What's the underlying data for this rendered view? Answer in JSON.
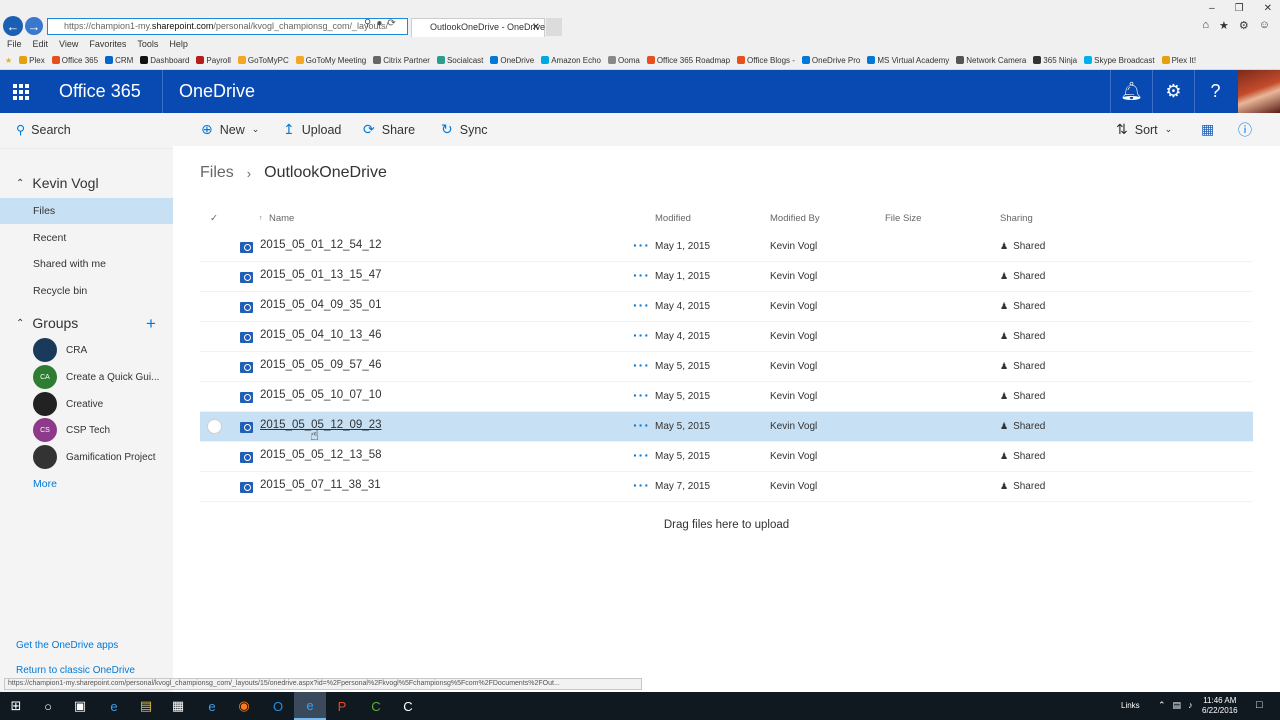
{
  "browser": {
    "address_prefix": "https://champion1-my.",
    "address_domain": "sharepoint.com",
    "address_suffix": "/personal/kvogl_championsg_com/_layouts/",
    "tab_title": "OutlookOneDrive - OneDrive",
    "status_url": "https://champion1-my.sharepoint.com/personal/kvogl_championsg_com/_layouts/15/onedrive.aspx?id=%2Fpersonal%2Fkvogl%5Fchampionsg%5Fcom%2FDocuments%2FOut..."
  },
  "menubar": [
    "File",
    "Edit",
    "View",
    "Favorites",
    "Tools",
    "Help"
  ],
  "favorites": [
    {
      "label": "Plex",
      "color": "#e5a00d"
    },
    {
      "label": "Office 365",
      "color": "#e84d1c"
    },
    {
      "label": "CRM",
      "color": "#0066cc"
    },
    {
      "label": "Dashboard",
      "color": "#111111"
    },
    {
      "label": "Payroll",
      "color": "#b71c1c"
    },
    {
      "label": "GoToMyPC",
      "color": "#f5a623"
    },
    {
      "label": "GoToMy Meeting",
      "color": "#f5a623"
    },
    {
      "label": "Citrix Partner",
      "color": "#666666"
    },
    {
      "label": "Socialcast",
      "color": "#2a9d8f"
    },
    {
      "label": "OneDrive",
      "color": "#0078d7"
    },
    {
      "label": "Amazon Echo",
      "color": "#00a8e1"
    },
    {
      "label": "Ooma",
      "color": "#888888"
    },
    {
      "label": "Office 365 Roadmap",
      "color": "#e84d1c"
    },
    {
      "label": "Office Blogs -",
      "color": "#e84d1c"
    },
    {
      "label": "OneDrive Pro",
      "color": "#0078d7"
    },
    {
      "label": "MS Virtual Academy",
      "color": "#0078d7"
    },
    {
      "label": "Network Camera",
      "color": "#555555"
    },
    {
      "label": "365 Ninja",
      "color": "#333333"
    },
    {
      "label": "Skype Broadcast",
      "color": "#00aff0"
    },
    {
      "label": "Plex It!",
      "color": "#e5a00d"
    }
  ],
  "suite": {
    "brand": "Office 365",
    "app": "OneDrive"
  },
  "leftnav": {
    "search": "Search",
    "user": "Kevin Vogl",
    "items": [
      "Files",
      "Recent",
      "Shared with me",
      "Recycle bin"
    ],
    "groups_title": "Groups",
    "groups": [
      {
        "name": "CRA",
        "initials": "",
        "color": "#1a3a5c"
      },
      {
        "name": "Create a Quick Gui...",
        "initials": "CA",
        "color": "#2e7d32"
      },
      {
        "name": "Creative",
        "initials": "",
        "color": "#222222"
      },
      {
        "name": "CSP Tech",
        "initials": "CS",
        "color": "#8e3a8a"
      },
      {
        "name": "Gamification Project",
        "initials": "",
        "color": "#333333"
      }
    ],
    "more": "More",
    "get_apps": "Get the OneDrive apps",
    "classic": "Return to classic OneDrive"
  },
  "commands": {
    "new": "New",
    "upload": "Upload",
    "share": "Share",
    "sync": "Sync",
    "sort": "Sort"
  },
  "breadcrumb": {
    "root": "Files",
    "current": "OutlookOneDrive"
  },
  "columns": {
    "name": "Name",
    "modified": "Modified",
    "modified_by": "Modified By",
    "size": "File Size",
    "sharing": "Sharing"
  },
  "files": [
    {
      "name": "2015_05_01_12_54_12",
      "modified": "May 1, 2015",
      "by": "Kevin Vogl",
      "sharing": "Shared"
    },
    {
      "name": "2015_05_01_13_15_47",
      "modified": "May 1, 2015",
      "by": "Kevin Vogl",
      "sharing": "Shared"
    },
    {
      "name": "2015_05_04_09_35_01",
      "modified": "May 4, 2015",
      "by": "Kevin Vogl",
      "sharing": "Shared"
    },
    {
      "name": "2015_05_04_10_13_46",
      "modified": "May 4, 2015",
      "by": "Kevin Vogl",
      "sharing": "Shared"
    },
    {
      "name": "2015_05_05_09_57_46",
      "modified": "May 5, 2015",
      "by": "Kevin Vogl",
      "sharing": "Shared"
    },
    {
      "name": "2015_05_05_10_07_10",
      "modified": "May 5, 2015",
      "by": "Kevin Vogl",
      "sharing": "Shared"
    },
    {
      "name": "2015_05_05_12_09_23",
      "modified": "May 5, 2015",
      "by": "Kevin Vogl",
      "sharing": "Shared",
      "selected": true
    },
    {
      "name": "2015_05_05_12_13_58",
      "modified": "May 5, 2015",
      "by": "Kevin Vogl",
      "sharing": "Shared"
    },
    {
      "name": "2015_05_07_11_38_31",
      "modified": "May 7, 2015",
      "by": "Kevin Vogl",
      "sharing": "Shared"
    }
  ],
  "drag_hint": "Drag files here to upload",
  "taskbar": {
    "links": "Links",
    "time": "11:46 AM",
    "date": "6/22/2016"
  }
}
